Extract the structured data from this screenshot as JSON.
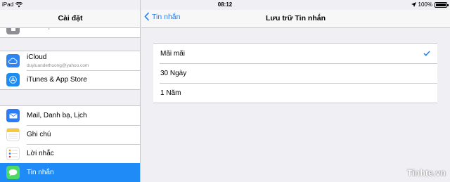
{
  "status_bar": {
    "device": "iPad",
    "time": "08:12",
    "battery": "100%",
    "battery_level": 1.0
  },
  "left_panel": {
    "title": "Cài đặt",
    "partial_item": "Bảo mật",
    "group1": [
      {
        "label": "iCloud",
        "sublabel": "duyluandethuong@yahoo.com",
        "icon": "icloud-icon",
        "color": "#2d84f3"
      },
      {
        "label": "iTunes & App Store",
        "icon": "app-store-icon",
        "color": "#1b8cf5"
      }
    ],
    "group2": [
      {
        "label": "Mail, Danh bạ, Lịch",
        "icon": "mail-icon",
        "color": "#2c7cf5"
      },
      {
        "label": "Ghi chú",
        "icon": "notes-icon",
        "color": "#f5c93a"
      },
      {
        "label": "Lời nhắc",
        "icon": "reminders-icon",
        "color": "#ffffff"
      },
      {
        "label": "Tin nhắn",
        "icon": "messages-icon",
        "color": "#4cd964",
        "selected": true
      }
    ]
  },
  "right_panel": {
    "back_label": "Tin nhắn",
    "title": "Lưu trữ Tin nhắn",
    "options": [
      {
        "label": "Mãi mãi",
        "checked": true
      },
      {
        "label": "30 Ngày",
        "checked": false
      },
      {
        "label": "1 Năm",
        "checked": false
      }
    ]
  },
  "watermark": "Tinhte.vn",
  "colors": {
    "accent": "#1e7df6",
    "selected_row": "#1e8bf6"
  }
}
